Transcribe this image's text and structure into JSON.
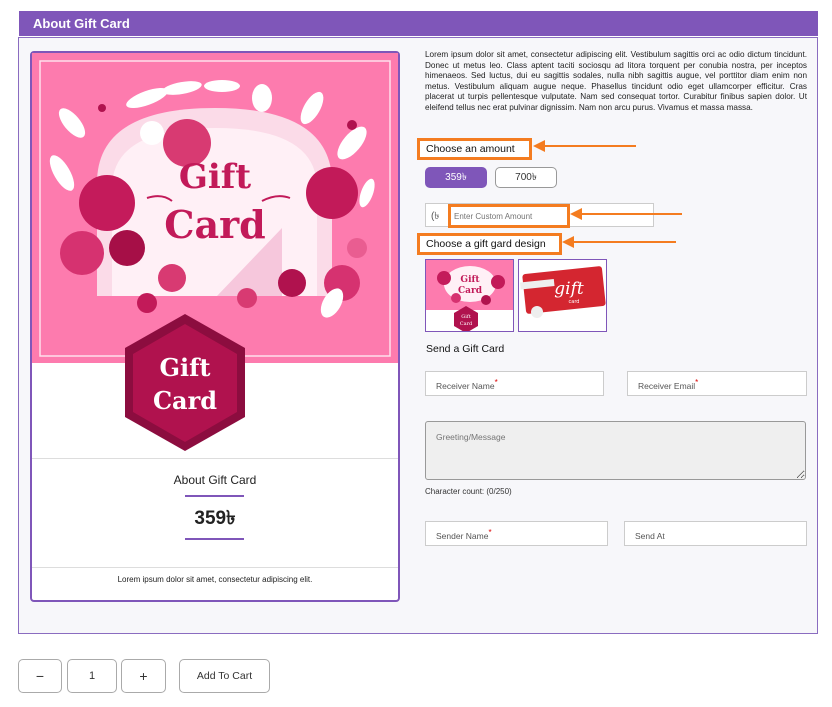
{
  "header": {
    "title": "About Gift Card"
  },
  "preview": {
    "card_text_1": "Gift",
    "card_text_2": "Card",
    "hex_text_1": "Gift",
    "hex_text_2": "Card",
    "title": "About Gift Card",
    "price": "359৳",
    "description": "Lorem ipsum dolor sit amet, consectetur adipiscing elit."
  },
  "product": {
    "description": "Lorem ipsum dolor sit amet, consectetur adipiscing elit. Vestibulum sagittis orci ac odio dictum tincidunt. Donec ut metus leo. Class aptent taciti sociosqu ad litora torquent per conubia nostra, per inceptos himenaeos. Sed luctus, dui eu sagittis sodales, nulla nibh sagittis augue, vel porttitor diam enim non metus. Vestibulum aliquam augue neque. Phasellus tincidunt odio eget ullamcorper efficitur. Cras placerat ut turpis pellentesque vulputate. Nam sed consequat tortor. Curabitur finibus sapien dolor. Ut eleifend tellus nec erat pulvinar dignissim. Nam non arcu purus. Vivamus et massa massa."
  },
  "amount": {
    "label": "Choose an amount",
    "options": [
      "359৳",
      "700৳"
    ],
    "selected": "359৳",
    "currency_symbol": "(৳",
    "custom_placeholder": "Enter Custom Amount"
  },
  "design": {
    "label": "Choose a gift gard design",
    "thumb1_text_1": "Gift",
    "thumb1_text_2": "Card",
    "thumb1_hex_1": "Gift",
    "thumb1_hex_2": "Card",
    "thumb2_text": "gift",
    "thumb2_sub": "card"
  },
  "send": {
    "title": "Send a Gift Card",
    "receiver_name": "Receiver Name",
    "receiver_email": "Receiver Email",
    "greeting_placeholder": "Greeting/Message",
    "char_count": "Character count: (0/250)",
    "sender_name": "Sender Name",
    "send_at": "Send At"
  },
  "cart": {
    "minus": "−",
    "quantity": "1",
    "plus": "+",
    "add_to_cart": "Add To Cart"
  },
  "colors": {
    "accent": "#7f56b9",
    "highlight": "#f47c20",
    "card_pink": "#f979ab",
    "card_magenta": "#b0124e"
  }
}
